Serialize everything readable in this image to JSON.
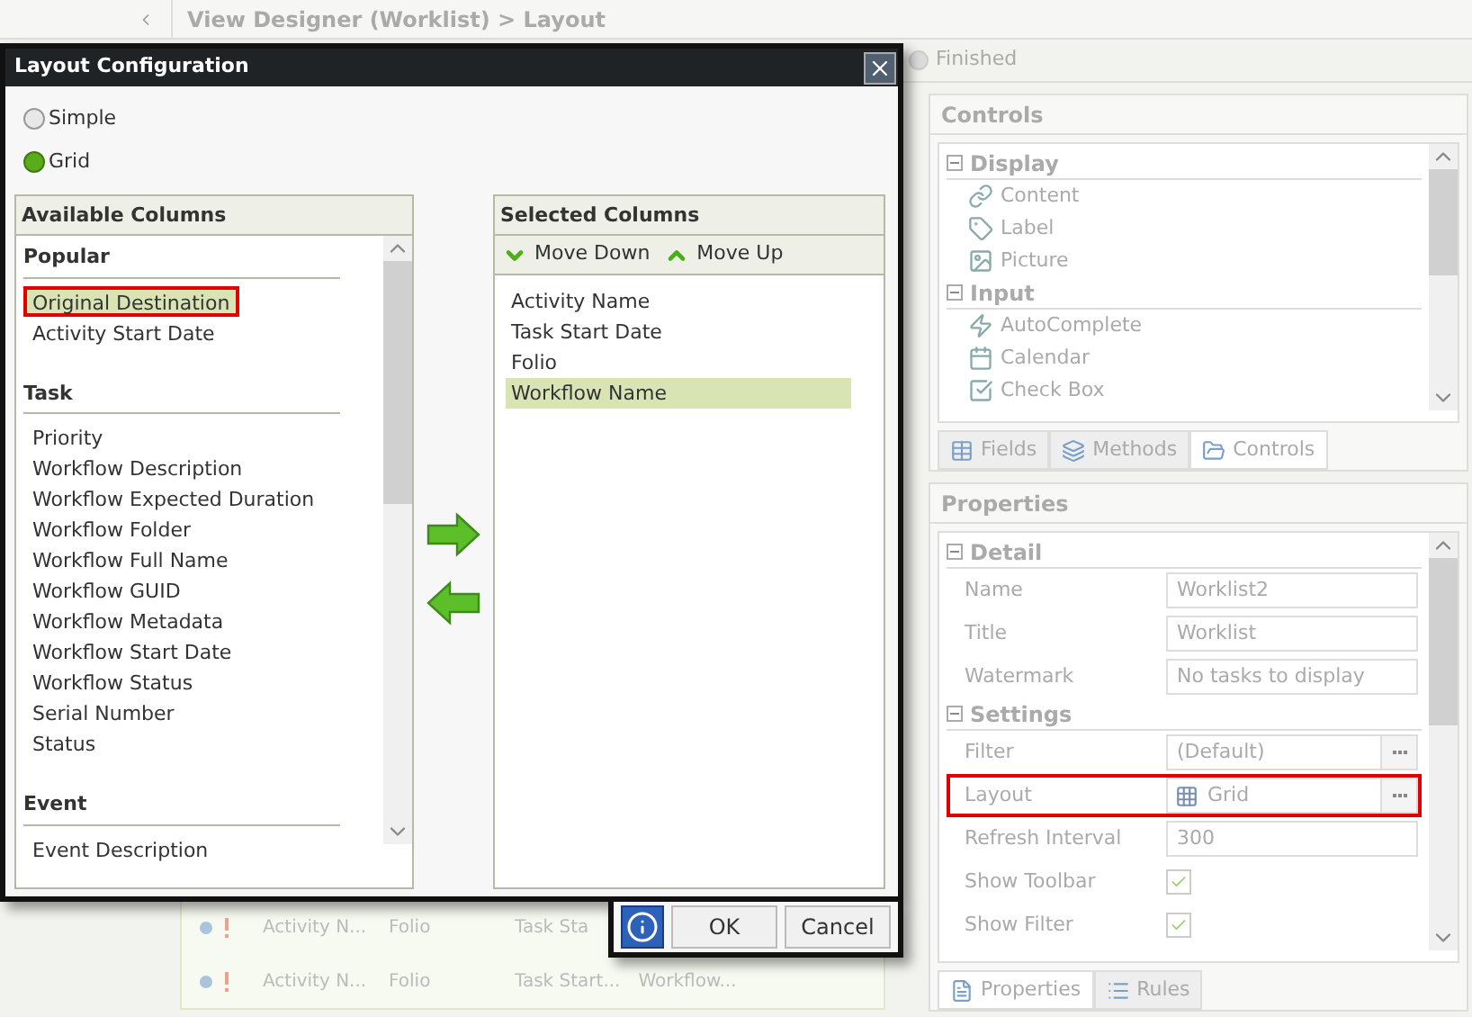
{
  "header": {
    "title": "View Designer (Worklist) > Layout"
  },
  "status": {
    "label": "Finished",
    "selected": false
  },
  "dialog": {
    "title": "Layout Configuration",
    "modes": [
      {
        "label": "Simple",
        "selected": false
      },
      {
        "label": "Grid",
        "selected": true
      }
    ],
    "available": {
      "title": "Available Columns",
      "groups": [
        {
          "name": "Popular",
          "items": [
            {
              "label": "Original Destination",
              "selected": true,
              "highlighted": true
            },
            {
              "label": "Activity Start Date",
              "selected": false,
              "highlighted": false
            }
          ]
        },
        {
          "name": "Task",
          "items": [
            {
              "label": "Priority",
              "selected": false,
              "highlighted": false
            },
            {
              "label": "Workflow Description",
              "selected": false,
              "highlighted": false
            },
            {
              "label": "Workflow Expected Duration",
              "selected": false,
              "highlighted": false
            },
            {
              "label": "Workflow Folder",
              "selected": false,
              "highlighted": false
            },
            {
              "label": "Workflow Full Name",
              "selected": false,
              "highlighted": false
            },
            {
              "label": "Workflow GUID",
              "selected": false,
              "highlighted": false
            },
            {
              "label": "Workflow Metadata",
              "selected": false,
              "highlighted": false
            },
            {
              "label": "Workflow Start Date",
              "selected": false,
              "highlighted": false
            },
            {
              "label": "Workflow Status",
              "selected": false,
              "highlighted": false
            },
            {
              "label": "Serial Number",
              "selected": false,
              "highlighted": false
            },
            {
              "label": "Status",
              "selected": false,
              "highlighted": false
            }
          ]
        },
        {
          "name": "Event",
          "items": [
            {
              "label": "Event Description",
              "selected": false,
              "highlighted": false
            }
          ]
        }
      ]
    },
    "selected_columns": {
      "title": "Selected Columns",
      "toolbar": [
        "Move Down",
        "Move Up"
      ],
      "items": [
        {
          "label": "Activity Name",
          "selected": false
        },
        {
          "label": "Task Start Date",
          "selected": false
        },
        {
          "label": "Folio",
          "selected": false
        },
        {
          "label": "Workflow Name",
          "selected": true
        }
      ]
    },
    "buttons": [
      "OK",
      "Cancel"
    ]
  },
  "grid_rows": [
    [
      "Activity N...",
      "Folio",
      "Task Sta"
    ],
    [
      "Activity N...",
      "Folio",
      "Task Start...",
      "Workflow..."
    ]
  ],
  "controls": {
    "title": "Controls",
    "groups": [
      {
        "name": "Display",
        "expanded": true,
        "items": [
          "Content",
          "Label",
          "Picture"
        ]
      },
      {
        "name": "Input",
        "expanded": true,
        "items": [
          "AutoComplete",
          "Calendar",
          "Check Box"
        ]
      }
    ],
    "tabs": [
      {
        "label": "Fields",
        "selected": false
      },
      {
        "label": "Methods",
        "selected": false
      },
      {
        "label": "Controls",
        "selected": true
      }
    ]
  },
  "properties": {
    "title": "Properties",
    "sections": [
      {
        "name": "Detail",
        "expanded": true,
        "rows": [
          {
            "kind": "text",
            "label": "Name",
            "value": "Worklist2",
            "highlighted": false
          },
          {
            "kind": "text",
            "label": "Title",
            "value": "Worklist",
            "highlighted": false
          },
          {
            "kind": "text",
            "label": "Watermark",
            "value": "No tasks to display",
            "highlighted": false
          }
        ]
      },
      {
        "name": "Settings",
        "expanded": true,
        "rows": [
          {
            "kind": "picker",
            "label": "Filter",
            "value": "(Default)",
            "highlighted": false
          },
          {
            "kind": "picker",
            "label": "Layout",
            "value": "Grid",
            "highlighted": true
          },
          {
            "kind": "text",
            "label": "Refresh Interval",
            "value": "300",
            "highlighted": false
          },
          {
            "kind": "checkbox",
            "label": "Show Toolbar",
            "checked": true,
            "highlighted": false
          },
          {
            "kind": "checkbox",
            "label": "Show Filter",
            "checked": true,
            "highlighted": false
          }
        ]
      }
    ],
    "tabs": [
      {
        "label": "Properties",
        "selected": true
      },
      {
        "label": "Rules",
        "selected": false
      }
    ]
  }
}
